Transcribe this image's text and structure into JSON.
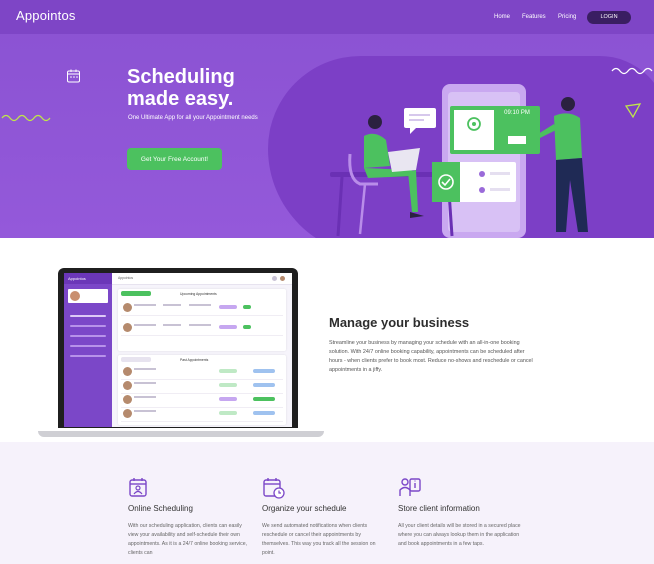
{
  "header": {
    "logo": "Appointos",
    "nav": [
      "Home",
      "Features",
      "Pricing"
    ],
    "login": "LOGIN"
  },
  "hero": {
    "title_line1": "Scheduling",
    "title_line2": "made easy.",
    "subtitle": "One Ultimate App for all your Appointment needs",
    "cta": "Get Your Free Account!",
    "card_time": "09:10 PM"
  },
  "manage": {
    "title": "Manage your business",
    "text": "Streamline your business by managing your schedule with an all-in-one booking solution. With 24/7 online booking capability, appointments can be scheduled after hours - when clients prefer to book most. Reduce no-shows and reschedule or cancel appointments in a jiffy.",
    "screen": {
      "brand": "Appointos",
      "panel1_title": "Upcoming Appointments",
      "panel2_title": "Past Appointments"
    }
  },
  "features": [
    {
      "title": "Online Scheduling",
      "text": "With our scheduling application, clients can easily view your availability and self-schedule their own appointments. As it is a 24/7 online booking service, clients can",
      "icon": "calendar-user-icon"
    },
    {
      "title": "Organize your schedule",
      "text": "We send automated notifications when clients reschedule or cancel their appointments by themselves. This way you track all the session on point.",
      "icon": "calendar-clock-icon"
    },
    {
      "title": "Store client information",
      "text": "All your client details will be stored in a secured place where you can always lookup them in the application and book appointments in a few taps.",
      "icon": "client-info-icon"
    }
  ],
  "colors": {
    "purple": "#8a52d2",
    "dark_purple": "#3a1e62",
    "green": "#4cc15f"
  }
}
